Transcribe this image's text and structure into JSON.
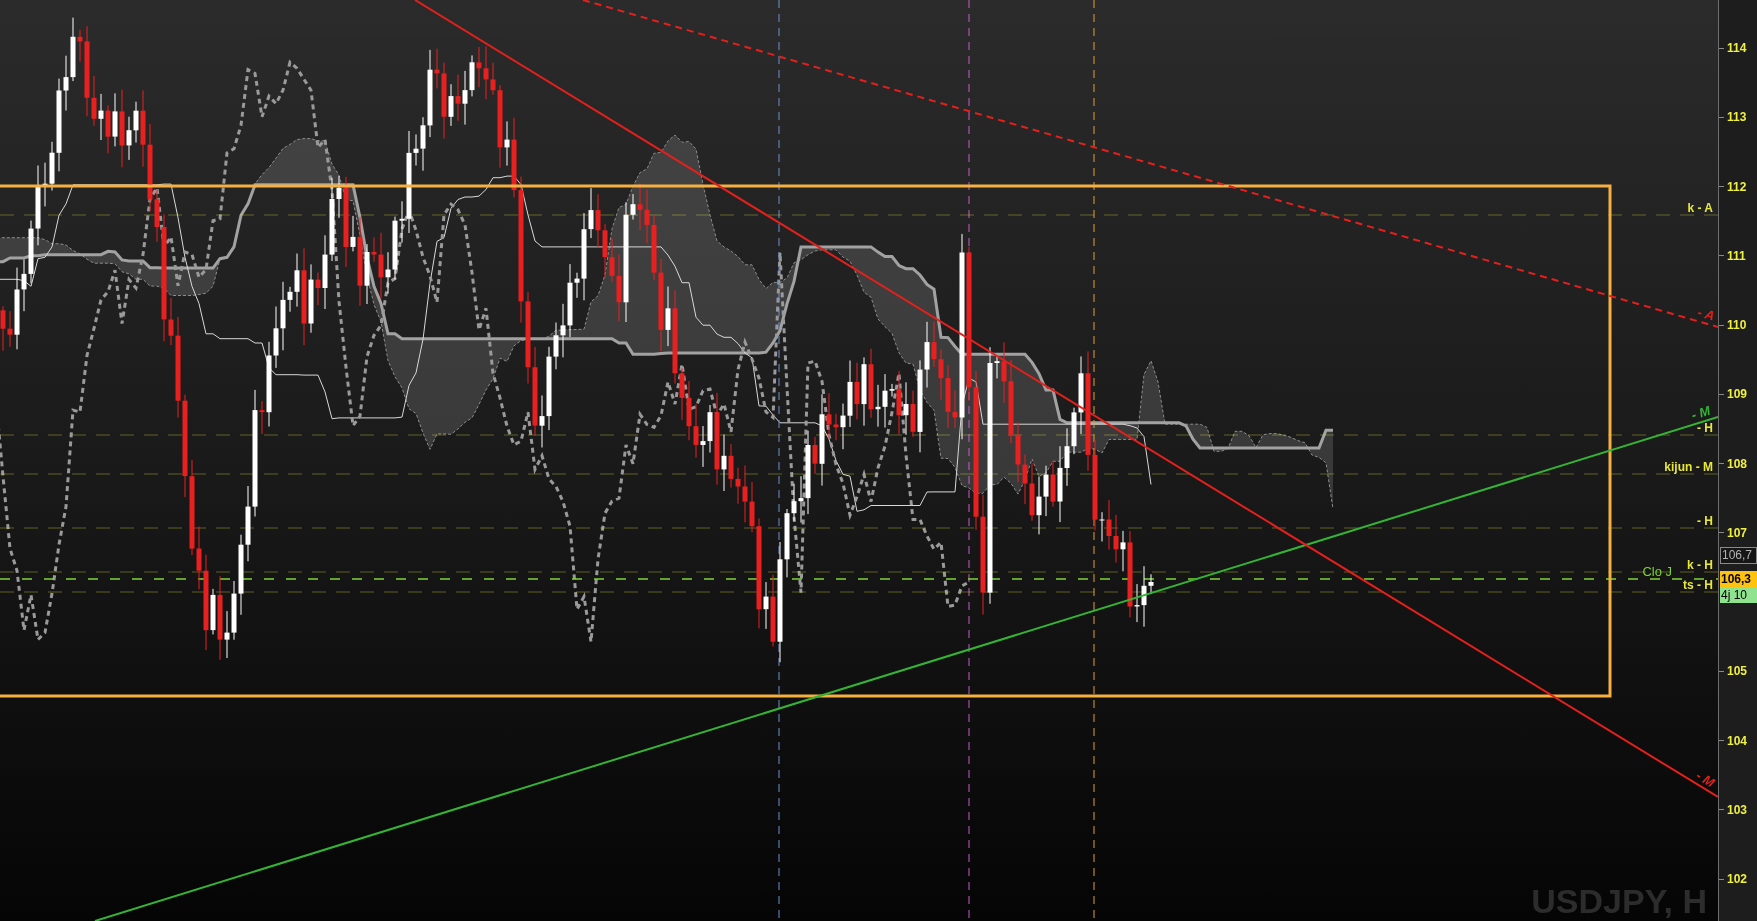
{
  "chart": {
    "symbol": "USDJPY, H"
  },
  "levels": [
    {
      "label": "k - A",
      "kind": "level",
      "color": "#e8e83a"
    },
    {
      "label": "- H",
      "kind": "level",
      "color": "#e8e83a"
    },
    {
      "label": "kijun - M",
      "kind": "level",
      "color": "#e8e83a"
    },
    {
      "label": "- H",
      "kind": "level",
      "color": "#e8e83a"
    },
    {
      "label": "Clo J",
      "kind": "close",
      "color": "#7dd335"
    },
    {
      "label": "k - H",
      "kind": "level",
      "color": "#e8e83a"
    },
    {
      "label": "ts - H",
      "kind": "level",
      "color": "#e8e83a"
    }
  ],
  "trend_lines": [
    {
      "label": "- A",
      "kind": "dashed",
      "color": "#e3201c"
    },
    {
      "label": "- M",
      "kind": "solid",
      "color": "#35b335"
    },
    {
      "label": "- M",
      "kind": "solid",
      "color": "#e3201c"
    }
  ],
  "price_axis": {
    "ticks": [
      "114",
      "113",
      "112",
      "111",
      "110",
      "109",
      "108",
      "107",
      "105",
      "104",
      "103",
      "102"
    ]
  },
  "price_badges": [
    {
      "text": "106,7",
      "kind": "bid"
    },
    {
      "text": "106,3",
      "kind": "last"
    },
    {
      "text": "4j 10",
      "kind": "timer"
    }
  ]
}
